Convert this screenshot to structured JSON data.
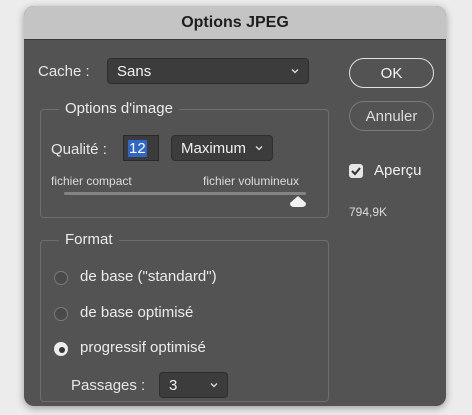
{
  "window": {
    "title": "Options JPEG"
  },
  "cache": {
    "label": "Cache :",
    "value": "Sans"
  },
  "image_options": {
    "title": "Options d'image",
    "quality_label": "Qualité :",
    "quality_value": "12",
    "quality_preset": "Maximum",
    "left_label": "fichier compact",
    "right_label": "fichier volumineux",
    "slider_fraction": 1.0
  },
  "format": {
    "title": "Format",
    "options": [
      {
        "label": "de base (\"standard\")",
        "selected": false
      },
      {
        "label": "de base optimisé",
        "selected": false
      },
      {
        "label": "progressif optimisé",
        "selected": true
      }
    ],
    "passes_label": "Passages :",
    "passes_value": "3"
  },
  "buttons": {
    "ok": "OK",
    "cancel": "Annuler"
  },
  "preview": {
    "label": "Aperçu",
    "checked": true,
    "file_size": "794,9K"
  },
  "icons": {
    "dropdown": "chevron-down-icon",
    "check": "checkmark-icon",
    "slider": "slider-thumb-icon"
  }
}
